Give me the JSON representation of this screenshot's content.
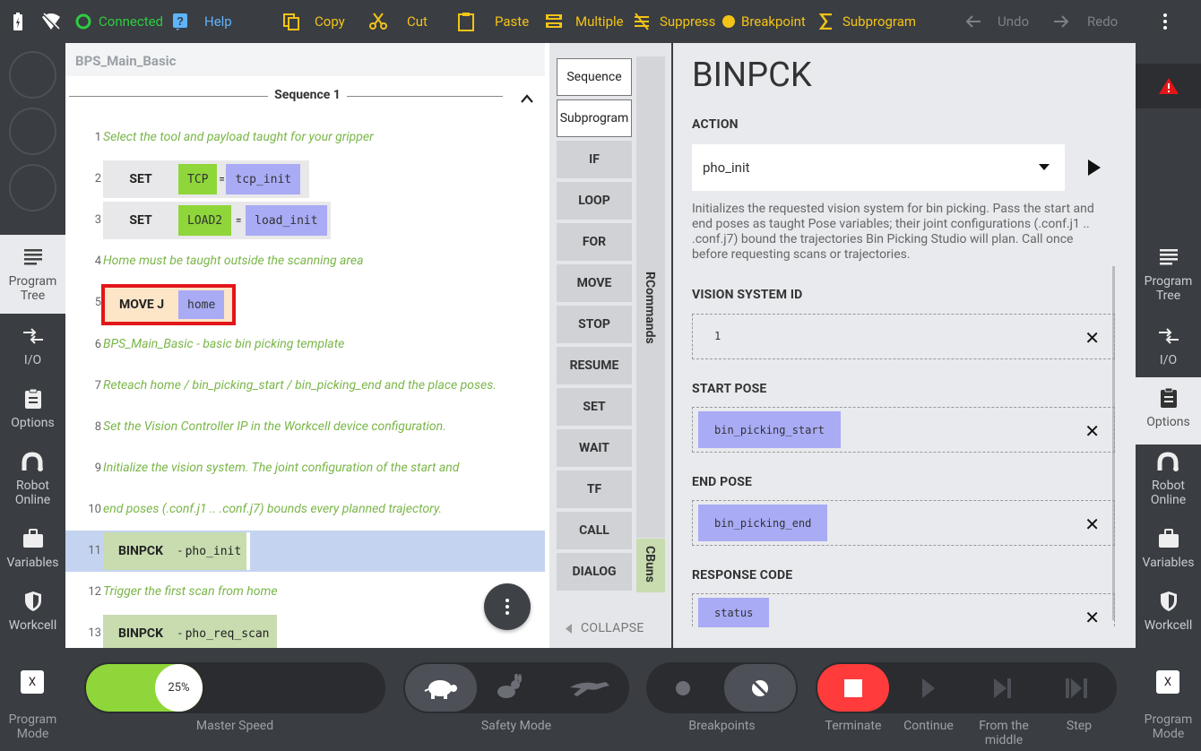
{
  "topbar": {
    "connected": "Connected",
    "help": "Help",
    "copy": "Copy",
    "cut": "Cut",
    "paste": "Paste",
    "multiple": "Multiple",
    "suppress": "Suppress",
    "breakpoint": "Breakpoint",
    "subprogram": "Subprogram",
    "undo": "Undo",
    "redo": "Redo"
  },
  "left_nav": [
    {
      "label1": "Program",
      "label2": "Tree"
    },
    {
      "label": "I/O"
    },
    {
      "label": "Options"
    },
    {
      "label1": "Robot",
      "label2": "Online"
    },
    {
      "label": "Variables"
    },
    {
      "label": "Workcell"
    }
  ],
  "right_nav": [
    {
      "label1": "Program",
      "label2": "Tree"
    },
    {
      "label": "I/O"
    },
    {
      "label": "Options"
    },
    {
      "label1": "Robot",
      "label2": "Online"
    },
    {
      "label": "Variables"
    },
    {
      "label": "Workcell"
    }
  ],
  "program": {
    "title": "BPS_Main_Basic",
    "sequence": "Sequence 1",
    "lines": [
      {
        "n": "1",
        "text": "Select the tool and payload taught for your gripper"
      },
      {
        "n": "2",
        "cmd": "SET",
        "var": "TCP",
        "eq": "=",
        "val": "tcp_init"
      },
      {
        "n": "3",
        "cmd": "SET",
        "var": "LOAD2",
        "eq": "=",
        "val": "load_init"
      },
      {
        "n": "4",
        "text": "Home must be taught outside the scanning area"
      },
      {
        "n": "5",
        "cmd": "MOVE J",
        "val": "home"
      },
      {
        "n": "6",
        "text": "BPS_Main_Basic - basic bin picking template"
      },
      {
        "n": "7",
        "text": "Reteach home / bin_picking_start / bin_picking_end and the place poses."
      },
      {
        "n": "8",
        "text": "Set the Vision Controller IP in the Workcell device configuration."
      },
      {
        "n": "9",
        "text": "Initialize the vision system. The joint configuration of the start and"
      },
      {
        "n": "10",
        "text": "end poses (.conf.j1 .. .conf.j7) bounds every planned trajectory."
      },
      {
        "n": "11",
        "cmd": "BINPCK",
        "dash": "-",
        "val": "pho_init"
      },
      {
        "n": "12",
        "text": "Trigger the first scan from home"
      },
      {
        "n": "13",
        "cmd": "BINPCK",
        "dash": "-",
        "val": "pho_req_scan"
      }
    ]
  },
  "commands": {
    "buttons": [
      "Sequence",
      "Subprogram",
      "IF",
      "LOOP",
      "FOR",
      "MOVE",
      "STOP",
      "RESUME",
      "SET",
      "WAIT",
      "TF",
      "CALL",
      "DIALOG"
    ],
    "rcommands": "RCommands",
    "cbuns": "CBuns",
    "collapse": "COLLAPSE"
  },
  "detail": {
    "title": "BINPCK",
    "action_label": "ACTION",
    "action_value": "pho_init",
    "description": "Initializes the requested vision system for bin picking. Pass the start and end poses as taught Pose variables; their joint configurations (.conf.j1 .. .conf.j7) bound the trajectories Bin Picking Studio will plan. Call once before requesting scans or trajectories.",
    "vision_label": "VISION SYSTEM ID",
    "vision_value": "1",
    "start_label": "START POSE",
    "start_value": "bin_picking_start",
    "end_label": "END POSE",
    "end_value": "bin_picking_end",
    "response_label": "RESPONSE CODE",
    "response_value": "status"
  },
  "bottom": {
    "program_mode1": "Program",
    "program_mode2": "Mode",
    "program_mode_key": "X",
    "speed": "25%",
    "speed_percent": 25,
    "master_speed": "Master Speed",
    "safety_mode": "Safety Mode",
    "breakpoints": "Breakpoints",
    "terminate": "Terminate",
    "continue": "Continue",
    "from_middle1": "From the",
    "from_middle2": "middle",
    "step": "Step"
  },
  "colors": {
    "accent": "#f3c316",
    "connected": "#2ecc40",
    "terminate": "#ff3b3b",
    "speed": "#8ed63a",
    "chip_green": "#8ed63a",
    "chip_blue": "#a9abf5",
    "selected_row": "#c4d3f0"
  }
}
